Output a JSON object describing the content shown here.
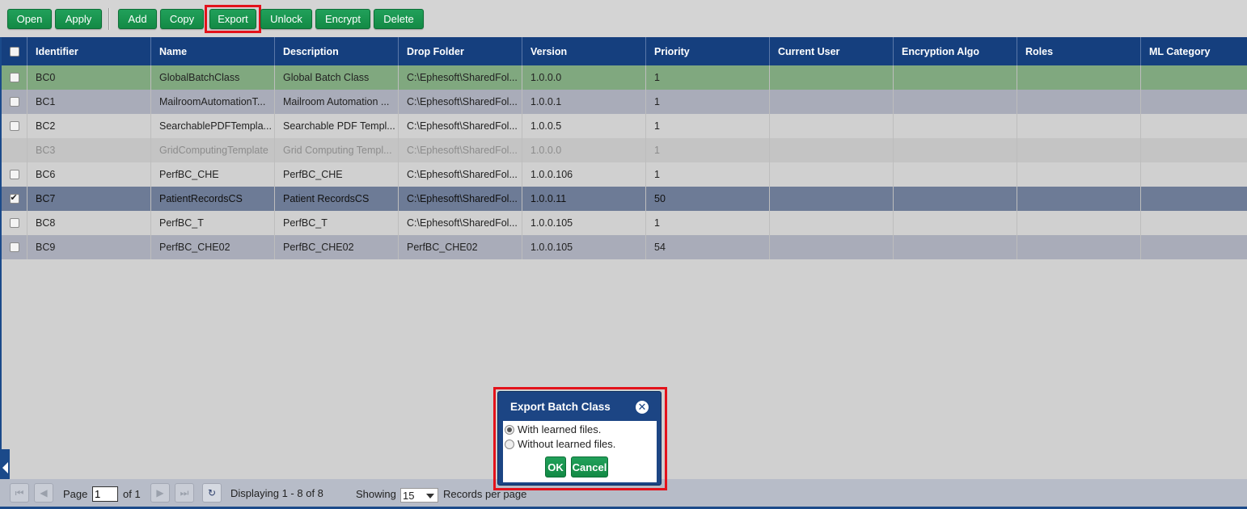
{
  "toolbar": {
    "buttons": [
      {
        "label": "Open"
      },
      {
        "label": "Apply"
      },
      {
        "label": "Add"
      },
      {
        "label": "Copy"
      },
      {
        "label": "Export"
      },
      {
        "label": "Unlock"
      },
      {
        "label": "Encrypt"
      },
      {
        "label": "Delete"
      }
    ]
  },
  "grid": {
    "columns": [
      "Identifier",
      "Name",
      "Description",
      "Drop Folder",
      "Version",
      "Priority",
      "Current User",
      "Encryption Algo",
      "Roles",
      "ML Category"
    ],
    "rows": [
      {
        "cells": [
          "BC0",
          "GlobalBatchClass",
          "Global Batch Class",
          "C:\\Ephesoft\\SharedFol...",
          "1.0.0.0",
          "1",
          "",
          "",
          "",
          ""
        ],
        "checked": false,
        "state": "highlighted"
      },
      {
        "cells": [
          "BC1",
          "MailroomAutomationT...",
          "Mailroom Automation ...",
          "C:\\Ephesoft\\SharedFol...",
          "1.0.0.1",
          "1",
          "",
          "",
          "",
          ""
        ],
        "checked": false,
        "state": "normal"
      },
      {
        "cells": [
          "BC2",
          "SearchablePDFTempla...",
          "Searchable PDF Templ...",
          "C:\\Ephesoft\\SharedFol...",
          "1.0.0.5",
          "1",
          "",
          "",
          "",
          ""
        ],
        "checked": false,
        "state": "normal"
      },
      {
        "cells": [
          "BC3",
          "GridComputingTemplate",
          "Grid Computing Templ...",
          "C:\\Ephesoft\\SharedFol...",
          "1.0.0.0",
          "1",
          "",
          "",
          "",
          ""
        ],
        "checked": false,
        "state": "disabled"
      },
      {
        "cells": [
          "BC6",
          "PerfBC_CHE",
          "PerfBC_CHE",
          "C:\\Ephesoft\\SharedFol...",
          "1.0.0.106",
          "1",
          "",
          "",
          "",
          ""
        ],
        "checked": false,
        "state": "normal"
      },
      {
        "cells": [
          "BC7",
          "PatientRecordsCS",
          "Patient RecordsCS",
          "C:\\Ephesoft\\SharedFol...",
          "1.0.0.11",
          "50",
          "",
          "",
          "",
          ""
        ],
        "checked": true,
        "state": "selected"
      },
      {
        "cells": [
          "BC8",
          "PerfBC_T",
          "PerfBC_T",
          "C:\\Ephesoft\\SharedFol...",
          "1.0.0.105",
          "1",
          "",
          "",
          "",
          ""
        ],
        "checked": false,
        "state": "normal"
      },
      {
        "cells": [
          "BC9",
          "PerfBC_CHE02",
          "PerfBC_CHE02",
          "PerfBC_CHE02",
          "1.0.0.105",
          "54",
          "",
          "",
          "",
          ""
        ],
        "checked": false,
        "state": "normal"
      }
    ]
  },
  "footer": {
    "page_label": "Page",
    "page_value": "1",
    "of_label": "of 1",
    "displaying": "Displaying 1 - 8 of 8",
    "showing_label": "Showing",
    "records_value": "15",
    "records_label": "Records per page"
  },
  "dialog": {
    "title": "Export Batch Class",
    "option_with": "With learned files.",
    "option_without": "Without learned files.",
    "ok_label": "OK",
    "cancel_label": "Cancel",
    "selected_option": "With learned files."
  },
  "colors": {
    "header_bg": "#153f7e",
    "button_green": "#138a45",
    "highlight_red": "#e3121b",
    "selected_row": "#6d7b96",
    "highlighted_row": "#80a87f"
  }
}
